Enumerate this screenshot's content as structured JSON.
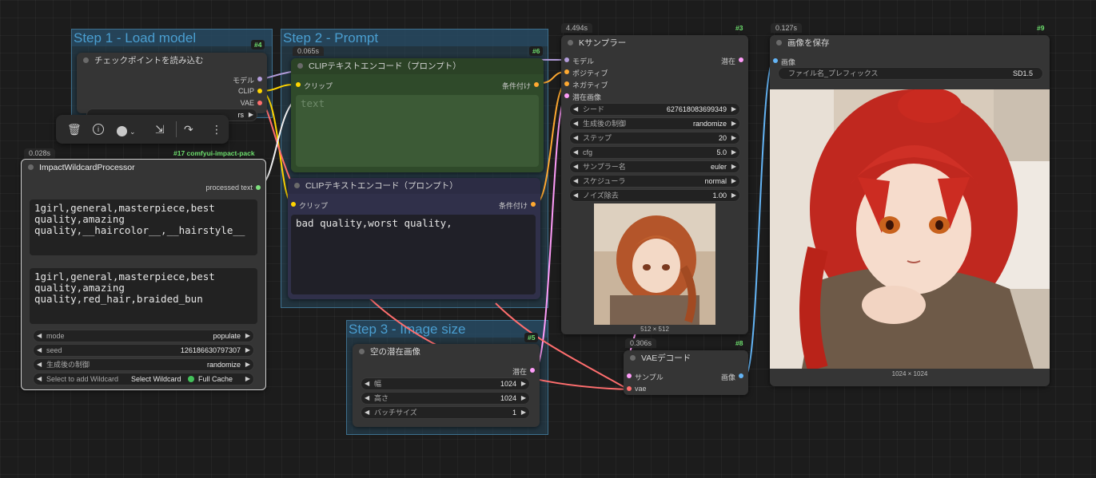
{
  "groups": {
    "load_model": "Step 1 - Load model",
    "prompt": "Step 2 - Prompt",
    "image_size": "Step 3 - Image size"
  },
  "checkpoint_node": {
    "title": "チェックポイントを読み込む",
    "id": "#4",
    "outputs": [
      "モデル",
      "CLIP",
      "VAE"
    ],
    "ckpt_partial": "rs"
  },
  "toolbar": {
    "delete_icon": "trash-icon",
    "info_icon": "info-icon",
    "color_icon": "color-circle-icon",
    "collapse_icon": "collapse-arrows-icon",
    "bypass_icon": "redo-arrow-icon",
    "more_icon": "more-vertical-icon"
  },
  "wildcard_node": {
    "timing": "0.028s",
    "id": "#17 comfyui-impact-pack",
    "title": "ImpactWildcardProcessor",
    "output": "processed text",
    "wildcard_text": "1girl,general,masterpiece,best quality,amazing quality,__haircolor__,__hairstyle__",
    "populated_text": "1girl,general,masterpiece,best quality,amazing quality,red_hair,braided_bun",
    "mode_label": "mode",
    "mode_value": "populate",
    "seed_label": "seed",
    "seed_value": "126186630797307",
    "control_label": "生成後の制御",
    "control_value": "randomize",
    "select_label": "Select to add Wildcard",
    "select_value": "Select Wildcard",
    "cache_label": "Full Cache"
  },
  "clip_pos": {
    "timing": "0.065s",
    "id": "#6",
    "title": "CLIPテキストエンコード（プロンプト）",
    "input": "クリップ",
    "output": "条件付け",
    "placeholder": "text"
  },
  "clip_neg": {
    "title": "CLIPテキストエンコード（プロンプト）",
    "input": "クリップ",
    "output": "条件付け",
    "text": "bad quality,worst quality,"
  },
  "latent_node": {
    "id": "#5",
    "title": "空の潜在画像",
    "output": "潜在",
    "width_label": "幅",
    "width_value": "1024",
    "height_label": "高さ",
    "height_value": "1024",
    "batch_label": "バッチサイズ",
    "batch_value": "1"
  },
  "sampler_node": {
    "timing": "4.494s",
    "id": "#3",
    "title": "Kサンプラー",
    "inputs": [
      "モデル",
      "ポジティブ",
      "ネガティブ",
      "潜在画像"
    ],
    "output": "潜在",
    "widgets": [
      {
        "label": "シード",
        "value": "627618083699349"
      },
      {
        "label": "生成後の制御",
        "value": "randomize"
      },
      {
        "label": "ステップ",
        "value": "20"
      },
      {
        "label": "cfg",
        "value": "5.0"
      },
      {
        "label": "サンプラー名",
        "value": "euler"
      },
      {
        "label": "スケジューラ",
        "value": "normal"
      },
      {
        "label": "ノイズ除去",
        "value": "1.00"
      }
    ],
    "preview_size": "512 × 512"
  },
  "vae_node": {
    "timing": "0.306s",
    "id": "#8",
    "title": "VAEデコード",
    "inputs": [
      "サンプル",
      "vae"
    ],
    "output": "画像"
  },
  "save_node": {
    "timing": "0.127s",
    "id": "#9",
    "title": "画像を保存",
    "input": "画像",
    "prefix_label": "ファイル名_プレフィックス",
    "prefix_value": "SD1.5",
    "image_size": "1024 × 1024"
  },
  "colors": {
    "model": "#b39ddb",
    "clip": "#ffd500",
    "vae": "#ff6e6e",
    "conditioning": "#ffa931",
    "latent": "#ff9cf9",
    "image": "#64b5f6",
    "string": "#7ee07e"
  }
}
